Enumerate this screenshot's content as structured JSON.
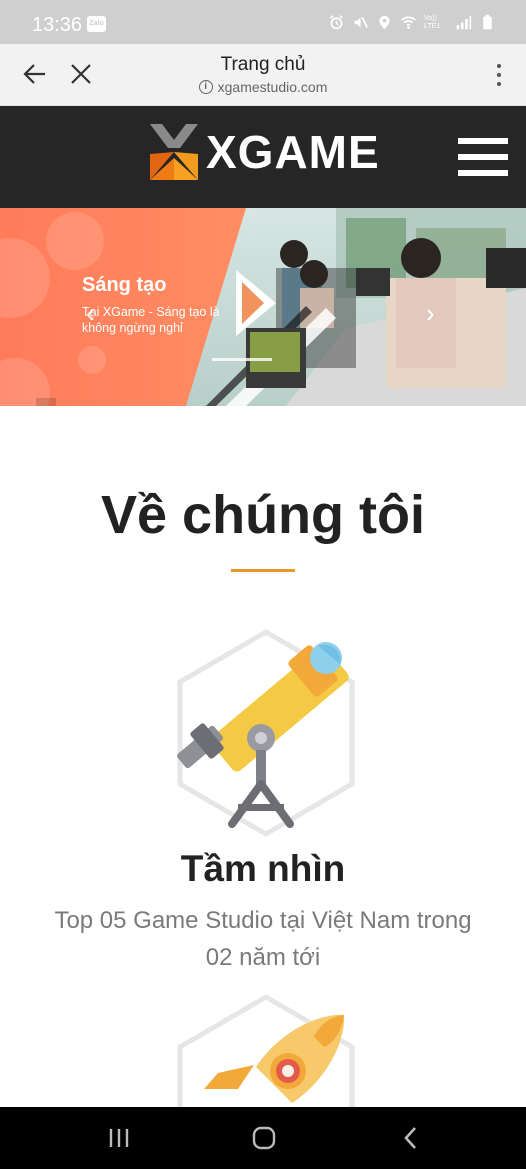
{
  "status_bar": {
    "time": "13:36",
    "zalo_label": "Zalo",
    "network_label": "Vo)) LTE1"
  },
  "browser": {
    "title": "Trang chủ",
    "url": "xgamestudio.com"
  },
  "site": {
    "logo_text": "XGAME"
  },
  "hero": {
    "title": "Sáng tạo",
    "subtitle": "Tại XGame - Sáng tạo là không ngừng nghỉ"
  },
  "about": {
    "heading": "Về chúng tôi",
    "feature": {
      "title": "Tầm nhìn",
      "description": "Top 05 Game Studio tại Việt Nam trong 02 năm tới"
    }
  },
  "colors": {
    "header_bg": "#262626",
    "accent_orange": "#e9962a",
    "hero_orange": "#ff7b5a",
    "status_bar_bg": "#cfcfcf"
  },
  "icons": {
    "back": "arrow-left-icon",
    "close": "close-icon",
    "menu": "more-vertical-icon",
    "info": "info-icon",
    "hamburger": "hamburger-menu-icon",
    "feature": "telescope-icon",
    "next_feature": "rocket-icon"
  }
}
